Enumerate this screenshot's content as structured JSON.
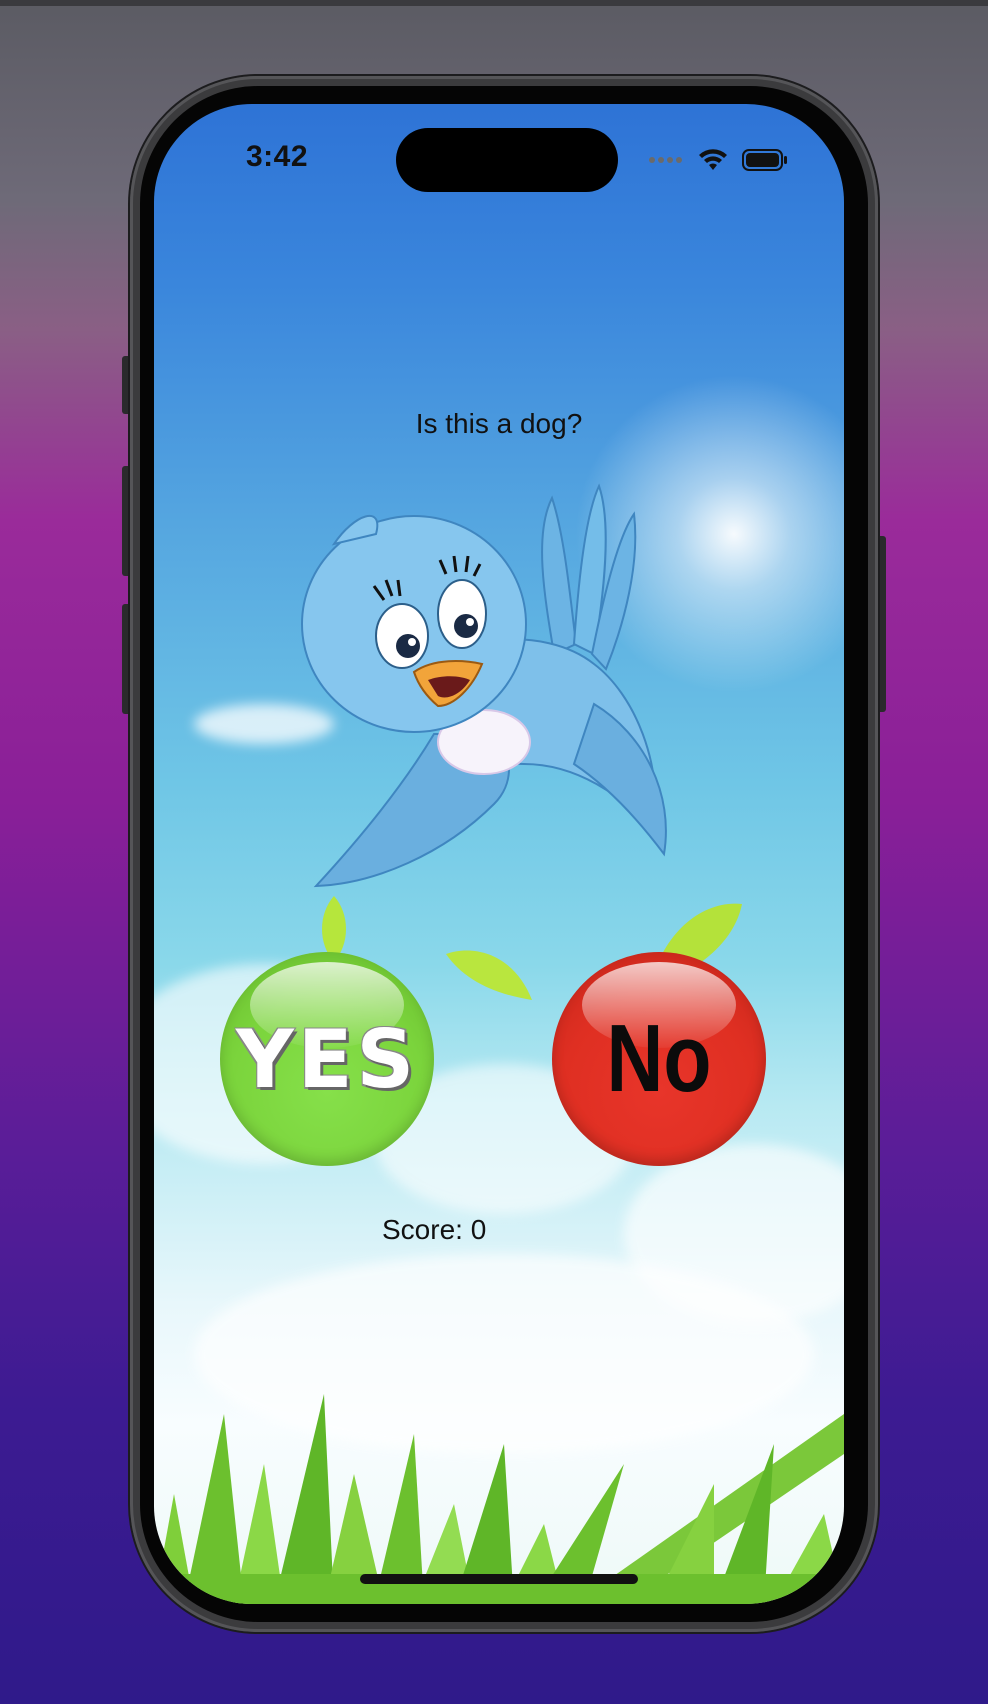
{
  "status_bar": {
    "time": "3:42",
    "icons": [
      "signal-dots-icon",
      "wifi-icon",
      "battery-icon"
    ]
  },
  "game": {
    "question": "Is this a dog?",
    "yes_label": "YES",
    "no_label": "No",
    "score_text": "Score: 0"
  },
  "colors": {
    "yes": "#7bd43c",
    "no": "#e0301f",
    "sky": "#3a86dc"
  }
}
